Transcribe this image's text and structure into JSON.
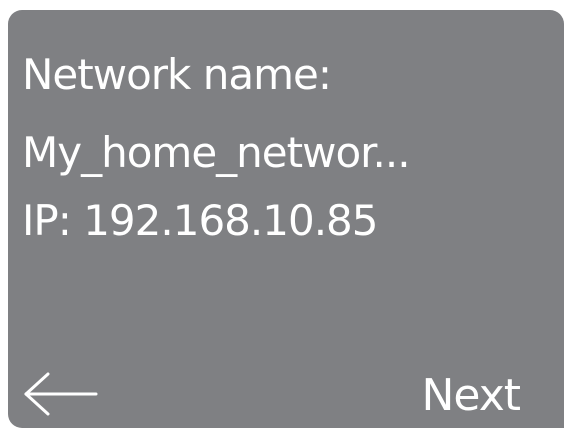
{
  "screen": {
    "title": "Network name:",
    "network_name": "My_home_networ...",
    "ip": "IP: 192.168.10.85"
  },
  "actions": {
    "back_icon": "arrow-left-icon",
    "next_label": "Next"
  },
  "colors": {
    "panel_bg": "#7f8083",
    "text": "#ffffff"
  }
}
